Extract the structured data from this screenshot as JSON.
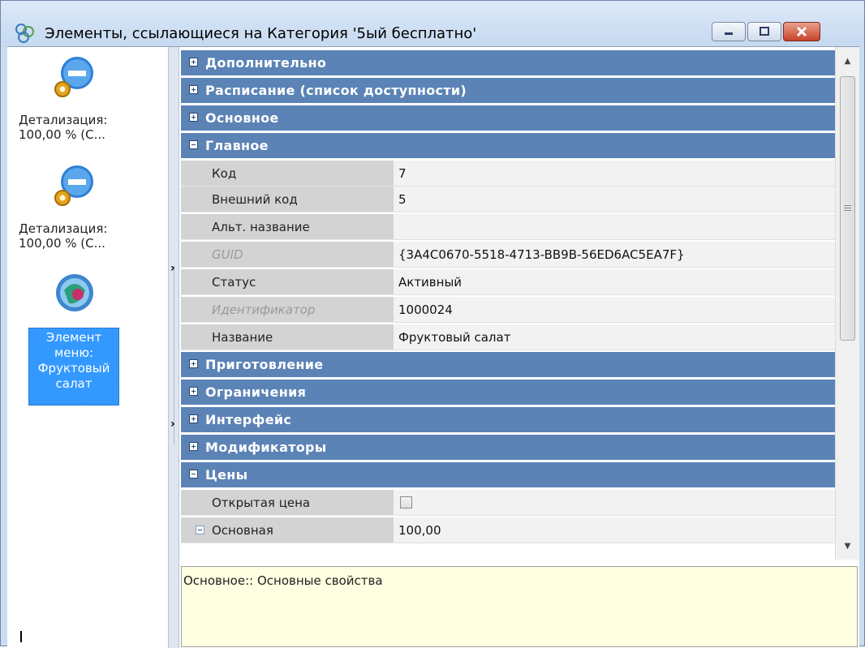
{
  "window": {
    "title": "Элементы, ссылающиеся на Категория '5ый бесплатно'",
    "icon": "linked-items-icon",
    "buttons": [
      "minimize-icon",
      "maximize-icon",
      "close-icon"
    ]
  },
  "left_list": {
    "items": [
      {
        "label_line1": "Детализация:",
        "label_line2": "100,00 % (С...",
        "icon": "detail-gear-icon"
      },
      {
        "label_line1": "Детализация:",
        "label_line2": "100,00 % (С...",
        "icon": "detail-gear-icon"
      },
      {
        "label_line1": "Элемент",
        "label_line2": "меню:",
        "label_line3": "Фруктовый",
        "label_line4": "салат",
        "icon": "menu-item-icon",
        "selected": true
      }
    ]
  },
  "grid": {
    "rows": [
      {
        "type": "category",
        "label": "Дополнительно",
        "expanded": false
      },
      {
        "type": "category",
        "label": "Расписание (список доступности)",
        "expanded": false
      },
      {
        "type": "category",
        "label": "Основное",
        "expanded": false
      },
      {
        "type": "category",
        "label": "Главное",
        "expanded": true
      },
      {
        "type": "property",
        "name": "Код",
        "value": "7"
      },
      {
        "type": "property",
        "name": "Внешний код",
        "value": "5"
      },
      {
        "type": "property",
        "name": "Альт. название",
        "value": ""
      },
      {
        "type": "property",
        "name": "GUID",
        "value": "{3A4C0670-5518-4713-BB9B-56ED6AC5EA7F}",
        "readonly": true
      },
      {
        "type": "property",
        "name": "Статус",
        "value": "Активный"
      },
      {
        "type": "property",
        "name": "Идентификатор",
        "value": "1000024",
        "readonly": true
      },
      {
        "type": "property",
        "name": "Название",
        "value": "Фруктовый салат"
      },
      {
        "type": "category",
        "label": "Приготовление",
        "expanded": false
      },
      {
        "type": "category",
        "label": "Ограничения",
        "expanded": false
      },
      {
        "type": "category",
        "label": "Интерфейс",
        "expanded": false
      },
      {
        "type": "category",
        "label": "Модификаторы",
        "expanded": false
      },
      {
        "type": "category",
        "label": "Цены",
        "expanded": true
      },
      {
        "type": "property",
        "name": "Открытая цена",
        "value": "",
        "checkbox": true,
        "checked": false
      },
      {
        "type": "property",
        "name": "Основная",
        "value": "100,00",
        "collapsible": true
      }
    ]
  },
  "help": {
    "text": "Основное:: Основные свойства"
  },
  "colors": {
    "category_bg": "#5b83b6",
    "selection_bg": "#3399ff",
    "help_bg": "#ffffe1"
  }
}
